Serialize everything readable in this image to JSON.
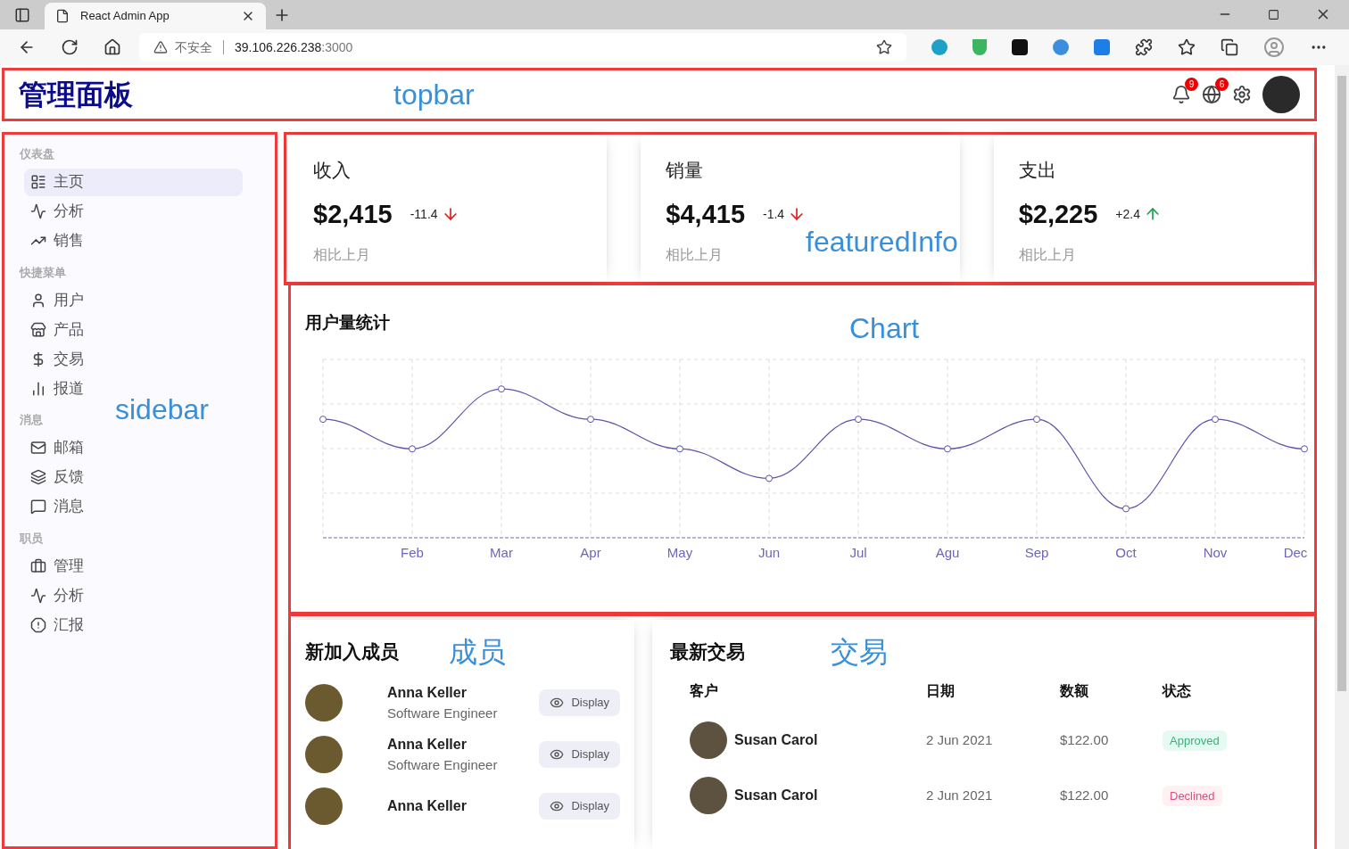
{
  "browser": {
    "tab_title": "React Admin App",
    "security": "不安全",
    "host": "39.106.226.238",
    "port": ":3000"
  },
  "topbar": {
    "logo": "管理面板",
    "annotation": "topbar",
    "notifications": [
      {
        "badge": "9"
      },
      {
        "badge": "6"
      }
    ]
  },
  "sidebar": {
    "annotation": "sidebar",
    "sections": [
      {
        "title": "仪表盘",
        "items": [
          {
            "label": "主页",
            "selected": true
          },
          {
            "label": "分析",
            "selected": false
          },
          {
            "label": "销售",
            "selected": false
          }
        ]
      },
      {
        "title": "快捷菜单",
        "items": [
          {
            "label": "用户",
            "selected": false
          },
          {
            "label": "产品",
            "selected": false
          },
          {
            "label": "交易",
            "selected": false
          },
          {
            "label": "报道",
            "selected": false
          }
        ]
      },
      {
        "title": "消息",
        "items": [
          {
            "label": "邮箱",
            "selected": false
          },
          {
            "label": "反馈",
            "selected": false
          },
          {
            "label": "消息",
            "selected": false
          }
        ]
      },
      {
        "title": "职员",
        "items": [
          {
            "label": "管理",
            "selected": false
          },
          {
            "label": "分析",
            "selected": false
          },
          {
            "label": "汇报",
            "selected": false
          }
        ]
      }
    ]
  },
  "featured": {
    "annotation": "featuredInfo",
    "cards": [
      {
        "title": "收入",
        "amount": "$2,415",
        "rate": "-11.4",
        "rising": false,
        "note": "相比上月"
      },
      {
        "title": "销量",
        "amount": "$4,415",
        "rate": "-1.4",
        "rising": false,
        "note": "相比上月"
      },
      {
        "title": "支出",
        "amount": "$2,225",
        "rate": "+2.4",
        "rising": true,
        "note": "相比上月"
      }
    ]
  },
  "chart": {
    "title": "用户量统计",
    "annotation": "Chart",
    "x_labels": [
      "Feb",
      "Mar",
      "Apr",
      "May",
      "Jun",
      "Jul",
      "Agu",
      "Sep",
      "Oct",
      "Nov",
      "Dec"
    ]
  },
  "members": {
    "title": "新加入成员",
    "annotation": "成员",
    "items": [
      {
        "name": "Anna Keller",
        "job": "Software Engineer",
        "button": "Display"
      },
      {
        "name": "Anna Keller",
        "job": "Software Engineer",
        "button": "Display"
      },
      {
        "name": "Anna Keller",
        "button": "Display"
      }
    ]
  },
  "transactions": {
    "title": "最新交易",
    "annotation": "交易",
    "columns": [
      "客户",
      "日期",
      "数额",
      "状态"
    ],
    "rows": [
      {
        "customer": "Susan Carol",
        "date": "2 Jun 2021",
        "amount": "$122.00",
        "status": {
          "label": "Approved",
          "kind": "approved"
        }
      },
      {
        "customer": "Susan Carol",
        "date": "2 Jun 2021",
        "amount": "$122.00",
        "status": {
          "label": "Declined",
          "kind": "declined"
        }
      }
    ]
  }
}
